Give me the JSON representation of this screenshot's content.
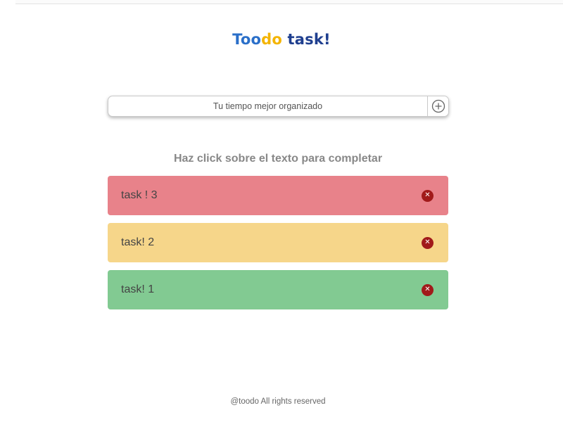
{
  "header": {
    "logo_part1": "Too",
    "logo_part2": "do",
    "logo_part3": " task!"
  },
  "input": {
    "placeholder": "Tu tiempo mejor organizado",
    "value": "",
    "add_icon": "plus-circle-icon"
  },
  "subtitle": "Haz click sobre el texto para completar",
  "tasks": [
    {
      "text": "task ! 3",
      "color": "#e8828a"
    },
    {
      "text": "task! 2",
      "color": "#f6d68a"
    },
    {
      "text": "task! 1",
      "color": "#82ca92"
    }
  ],
  "delete_icon": "close-circle-icon",
  "colors": {
    "logo_blue": "#2a6fc9",
    "logo_yellow": "#f4b400",
    "logo_green": "#2f9e44",
    "logo_navy": "#1f3f8f",
    "delete": "#a11a1a"
  },
  "footer": "@toodo All rights reserved"
}
